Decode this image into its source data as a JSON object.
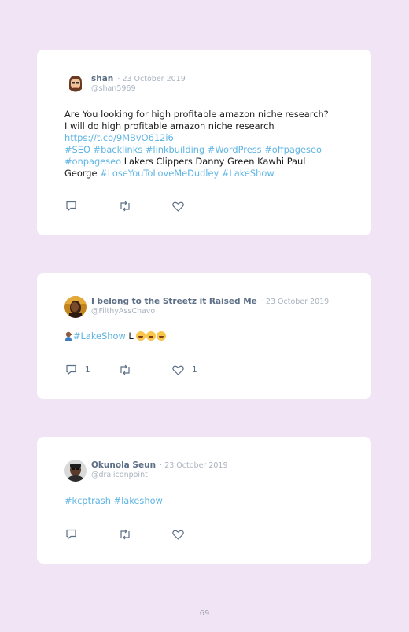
{
  "tweets": [
    {
      "name": "shan",
      "date": "23 October 2019",
      "handle": "@shan5969",
      "line1": "Are You looking for high profitable amazon niche research?",
      "line2": "I will do high profitable amazon niche research",
      "link": "https://t.co/9MBvO612i6",
      "tags1": "#SEO #backlinks #linkbuilding #WordPress #offpageseo",
      "tag_onpage": "#onpageseo",
      "text_mid": " Lakers Clippers Danny Green Kawhi Paul",
      "text_george": "George ",
      "tags2": "#LoseYouToLoveMeDudley #LakeShow"
    },
    {
      "name": "I belong to the Streetz it Raised Me",
      "date": "23 October 2019",
      "handle": "@FilthyAssChavo",
      "tag": "#LakeShow",
      "text": " L ",
      "emoji": "facepalm, laughing x3",
      "replies": "1",
      "likes": "1"
    },
    {
      "name": "Okunola Seun",
      "date": "23 October 2019",
      "handle": "@draliconpoint",
      "tags": "#kcptrash #lakeshow"
    }
  ],
  "page_number": "69",
  "colors": {
    "background": "#f1e4f5",
    "link": "#5fb5e3",
    "name": "#5c6f86",
    "muted": "#a9b3bf"
  }
}
